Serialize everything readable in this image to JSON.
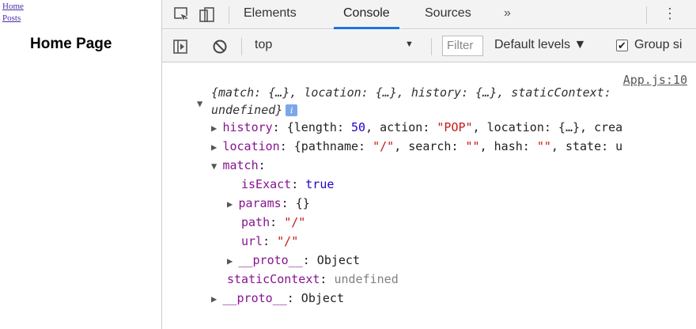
{
  "page": {
    "links": [
      "Home",
      "Posts"
    ],
    "heading": "Home Page"
  },
  "devtools": {
    "tabs": [
      "Elements",
      "Console",
      "Sources"
    ],
    "active_tab": "Console",
    "more_tabs": "»",
    "context": "top",
    "filter_placeholder": "Filter",
    "levels": "Default levels ▼",
    "group_label": "Group si",
    "accent": "#1a73e8"
  },
  "console": {
    "source": "App.js:10",
    "summary_1": "{match: {…}, location: {…}, history: {…}, staticContext:",
    "summary_2": "undefined}",
    "info": "i",
    "history_key": "history",
    "history_rest_1": ": {length: ",
    "history_len": "50",
    "history_rest_2": ", action: ",
    "history_action": "\"POP\"",
    "history_rest_3": ", location: {…}, crea",
    "location_key": "location",
    "location_rest_1": ": {pathname: ",
    "location_path": "\"/\"",
    "location_rest_2": ", search: ",
    "location_search": "\"\"",
    "location_rest_3": ", hash: ",
    "location_hash": "\"\"",
    "location_rest_4": ", state: u",
    "match_key": "match",
    "isExact_key": "isExact",
    "isExact_val": "true",
    "params_key": "params",
    "params_val": "{}",
    "path_key": "path",
    "path_val": "\"/\"",
    "url_key": "url",
    "url_val": "\"/\"",
    "proto_key": "__proto__",
    "proto_val": "Object",
    "static_key": "staticContext",
    "static_val": "undefined",
    "proto2_key": "__proto__",
    "proto2_val": "Object"
  }
}
